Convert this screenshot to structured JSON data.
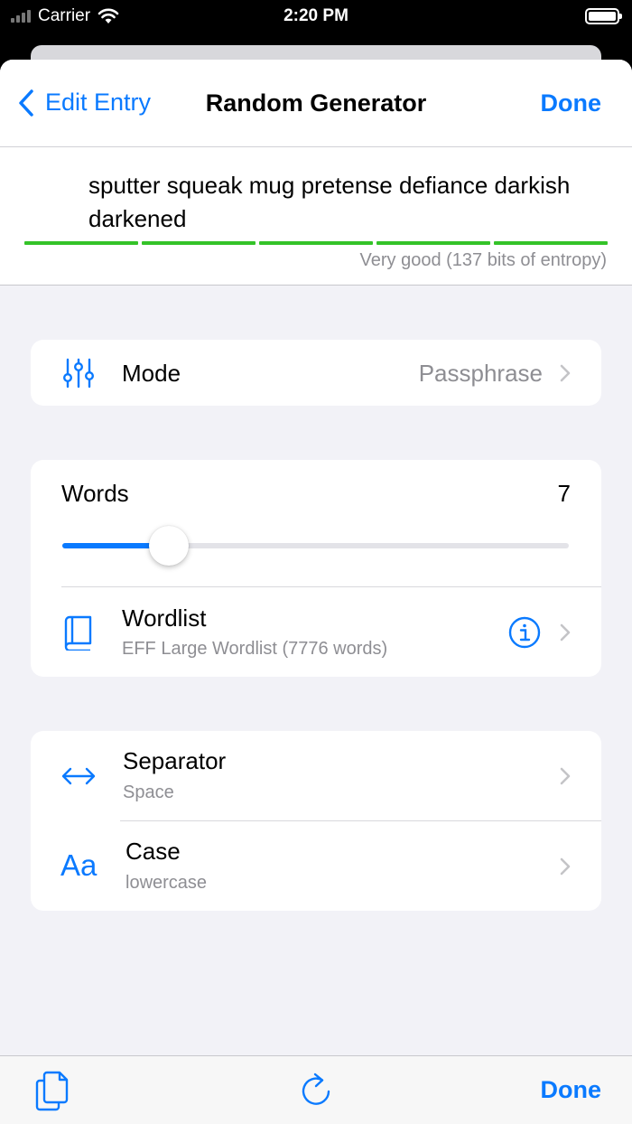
{
  "status_bar": {
    "carrier": "Carrier",
    "time": "2:20 PM"
  },
  "nav": {
    "back_label": "Edit Entry",
    "title": "Random Generator",
    "done_label": "Done"
  },
  "password": {
    "text": "sputter squeak mug pretense defiance darkish darkened",
    "strength_segments": 5,
    "strength_filled": 5,
    "entropy_label": "Very good (137 bits of entropy)"
  },
  "mode": {
    "label": "Mode",
    "value": "Passphrase",
    "icon": "sliders-icon"
  },
  "words": {
    "label": "Words",
    "count": "7",
    "slider_fraction": 0.21
  },
  "wordlist": {
    "label": "Wordlist",
    "subtitle": "EFF Large Wordlist (7776 words)",
    "icon": "book-icon",
    "info_icon": "info-icon"
  },
  "separator": {
    "label": "Separator",
    "value": "Space",
    "icon": "left-right-arrow-icon"
  },
  "case": {
    "label": "Case",
    "value": "lowercase",
    "icon_text": "Aa"
  },
  "toolbar": {
    "done_label": "Done",
    "copy_icon": "copy-icon",
    "regenerate_icon": "refresh-icon"
  },
  "colors": {
    "accent": "#0a7aff",
    "strength": "#34c328",
    "secondary_text": "#8e8e93",
    "background": "#f2f2f7"
  }
}
